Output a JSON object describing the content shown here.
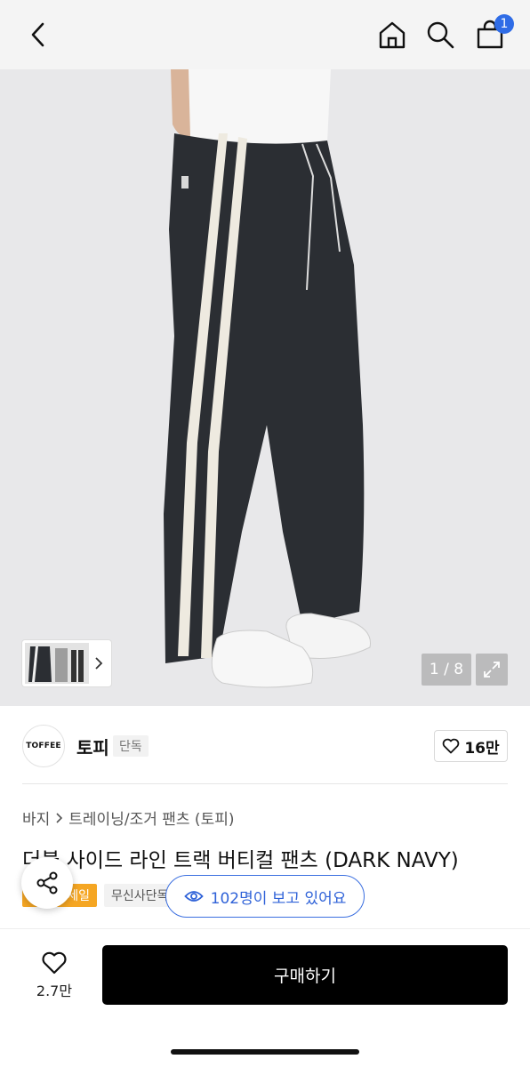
{
  "header": {
    "cart_count": "1",
    "icons": [
      "chevron-left-icon",
      "home-icon",
      "search-icon",
      "shopping-bag-icon"
    ],
    "badge_color": "#2f6ce6"
  },
  "gallery": {
    "page_counter": "1 / 8",
    "icons": [
      "chevron-right-icon",
      "expand-icon"
    ]
  },
  "brand": {
    "logo_text": "TOFFEE",
    "name": "토피",
    "tag": "단독",
    "likes": "16만"
  },
  "product": {
    "breadcrumb": [
      "바지",
      "트레이닝/조거 팬츠 (토피)"
    ],
    "title": "더블 사이드 라인 트랙 버티컬 팬츠 (DARK NAVY)",
    "badges": {
      "sale": "세일",
      "exclusive": "무신사단독"
    },
    "viewers": "102명이 보고 있어요",
    "accent_color": "#2f62d8",
    "sale_color": "#f5a623"
  },
  "bottom_bar": {
    "wish_count": "2.7만",
    "buy_label": "구매하기"
  }
}
